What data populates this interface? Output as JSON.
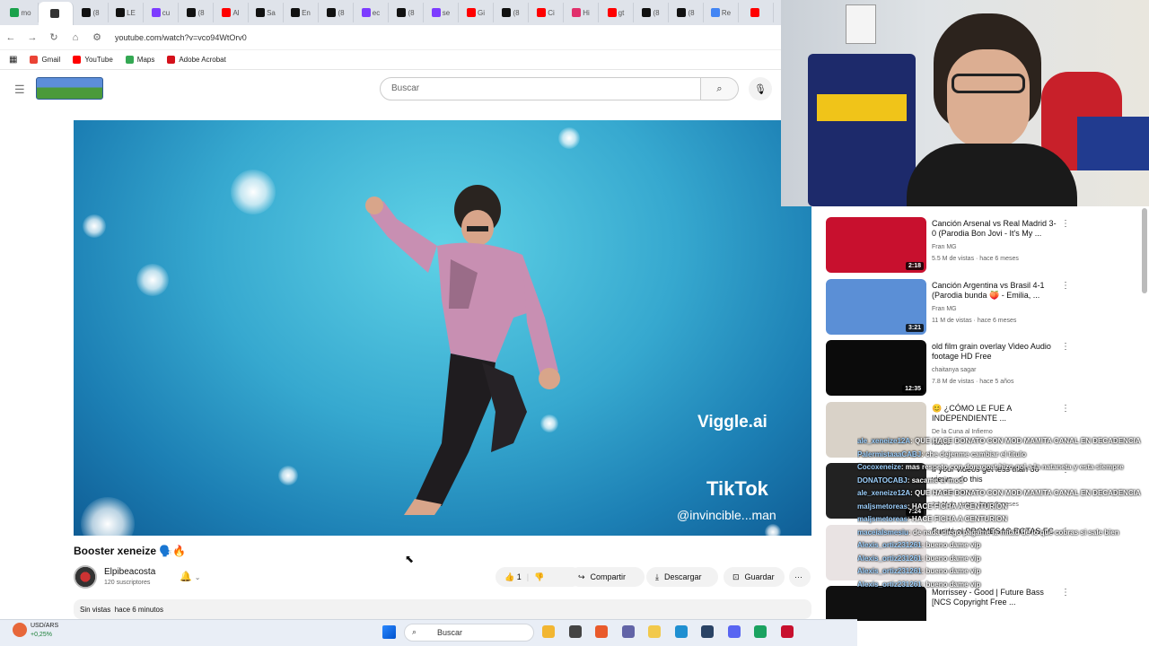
{
  "browser": {
    "tabs": [
      {
        "label": "mo",
        "color": "#1aa14b"
      },
      {
        "label": "",
        "color": "#333"
      },
      {
        "label": "(8",
        "color": "#111"
      },
      {
        "label": "LE",
        "color": "#111"
      },
      {
        "label": "cu",
        "color": "#7d3cff"
      },
      {
        "label": "(8",
        "color": "#111"
      },
      {
        "label": "Al",
        "color": "#ff0000"
      },
      {
        "label": "Sa",
        "color": "#111"
      },
      {
        "label": "En",
        "color": "#111"
      },
      {
        "label": "(8",
        "color": "#111"
      },
      {
        "label": "ec",
        "color": "#7d3cff"
      },
      {
        "label": "(8",
        "color": "#111"
      },
      {
        "label": "se",
        "color": "#7d3cff"
      },
      {
        "label": "Gi",
        "color": "#ff0000"
      },
      {
        "label": "(8",
        "color": "#111"
      },
      {
        "label": "Ci",
        "color": "#ff0000"
      },
      {
        "label": "Hi",
        "color": "#e1306c"
      },
      {
        "label": "gt",
        "color": "#ff0000"
      },
      {
        "label": "(8",
        "color": "#111"
      },
      {
        "label": "(8",
        "color": "#111"
      },
      {
        "label": "Re",
        "color": "#4285f4"
      },
      {
        "label": "",
        "color": "#ff0000"
      }
    ],
    "url": "youtube.com/watch?v=vco94WtOrv0",
    "bookmarks": [
      {
        "label": "Gmail",
        "color": "#ea4335"
      },
      {
        "label": "YouTube",
        "color": "#ff0000"
      },
      {
        "label": "Maps",
        "color": "#34a853"
      },
      {
        "label": "Adobe Acrobat",
        "color": "#d4111b"
      }
    ]
  },
  "youtube": {
    "search_placeholder": "Buscar",
    "video": {
      "watermark": "Viggle.ai",
      "tiktok": "TikTok",
      "handle": "@invincible...man"
    },
    "title": "Booster xeneize 🗣️🔥",
    "channel": "Elpibeacosta",
    "subscribers": "120 suscriptores",
    "likes": "1",
    "share_label": "Compartir",
    "download_label": "Descargar",
    "save_label": "Guardar",
    "views": "Sin vistas",
    "age": "hace 6 minutos"
  },
  "recommendations": [
    {
      "title": "Canción Arsenal vs Real Madrid 3-0 (Parodia Bon Jovi - It's My ...",
      "channel": "Fran MG",
      "meta": "5.5 M de vistas · hace 6 meses",
      "duration": "2:18",
      "thumb": "#c8102e"
    },
    {
      "title": "Canción Argentina vs Brasil 4-1 (Parodia bunda 🍑 - Emilia, ...",
      "channel": "Fran MG",
      "meta": "11 M de vistas · hace 6 meses",
      "duration": "3:21",
      "thumb": "#5b8fd6"
    },
    {
      "title": "old film grain overlay  Video Audio footage HD Free",
      "channel": "chaitanya sagar",
      "meta": "7.8 M de vistas · hace 5 años",
      "duration": "12:35",
      "thumb": "#0b0b0b"
    },
    {
      "title": "😊 ¿CÓMO LE FUE A INDEPENDIENTE ...",
      "channel": "De la Cuna al Infierno",
      "meta": "Nuevo",
      "duration": "",
      "thumb": "#d9d2c8"
    },
    {
      "title": "If your videos get less than 50 views...do this",
      "channel": "Dan the creator",
      "meta": "2.1 M de vistas · hace 9 meses",
      "duration": "7:24",
      "thumb": "#222"
    },
    {
      "title": "Fundé el PROMESAS ROTAS FC",
      "channel": "",
      "meta": "",
      "duration": "",
      "thumb": "#e9e3e3"
    },
    {
      "title": "Morrissey - Good | Future Bass [NCS Copyright Free ...",
      "channel": "",
      "meta": "",
      "duration": "",
      "thumb": "#101010"
    }
  ],
  "chat": [
    {
      "user": "ale_xeneize12A",
      "text": ": QUE HACE DONATO CON MOD MAMITA CANAL EN DECADENCIA"
    },
    {
      "user": "PalermistaaaCABJ",
      "text": ": che dejenme cambiar el titulo"
    },
    {
      "user": "Cocoxeneize",
      "text": ": mas respeto con donagoat hizo gol a la nataneta y esta siempre"
    },
    {
      "user": "DONATOCABJ",
      "text": ": sacame el mod"
    },
    {
      "user": "ale_xeneize12A",
      "text": ": QUE HACE DONATO CON MOD MAMITA CANAL EN DECADENCIA"
    },
    {
      "user": "maljsmetoreas",
      "text": ": HACE FICHA A CENTURION"
    },
    {
      "user": "maljsmetoreas",
      "text": ": HACE FICHA A CENTURION"
    },
    {
      "user": "maceiaIsmesiu",
      "text": ": de nada diego pagame la mitad de lo que cobras si sale bien"
    },
    {
      "user": "Alexis_ortiz231261",
      "text": ": bueno dame vip"
    },
    {
      "user": "Alexis_ortiz231261",
      "text": ": bueno dame vip"
    },
    {
      "user": "Alexis_ortiz231261",
      "text": ": bueno dame vip"
    },
    {
      "user": "Alexis_ortiz231261",
      "text": ": bueno dame vip"
    }
  ],
  "taskbar": {
    "currency": "USD/ARS",
    "change": "+0,25%",
    "search": "Buscar",
    "apps": [
      "#f2b632",
      "#444",
      "#e95a2b",
      "#6264a7",
      "#f2c94c",
      "#1f8fd1",
      "#2a4365",
      "#5865f2",
      "#1aa260",
      "#c8102e"
    ]
  }
}
